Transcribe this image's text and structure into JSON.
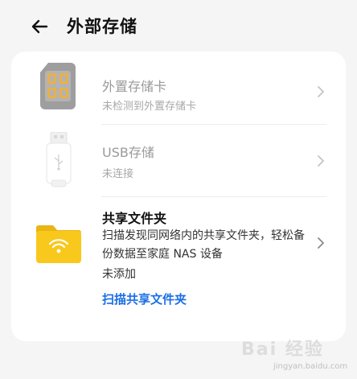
{
  "header": {
    "title": "外部存储"
  },
  "items": [
    {
      "title": "外置存储卡",
      "subtitle": "未检测到外置存储卡"
    },
    {
      "title": "USB存储",
      "subtitle": "未连接"
    },
    {
      "title": "共享文件夹",
      "description": "扫描发现同网络内的共享文件夹，轻松备份数据至家庭 NAS 设备",
      "status": "未添加",
      "link": "扫描共享文件夹"
    }
  ],
  "watermark": {
    "brand": "Bai 经验",
    "url": "jingyan.baidu.com"
  },
  "colors": {
    "link": "#1a6ee6",
    "folder": "#f5c518",
    "background": "#f5f5f5"
  }
}
